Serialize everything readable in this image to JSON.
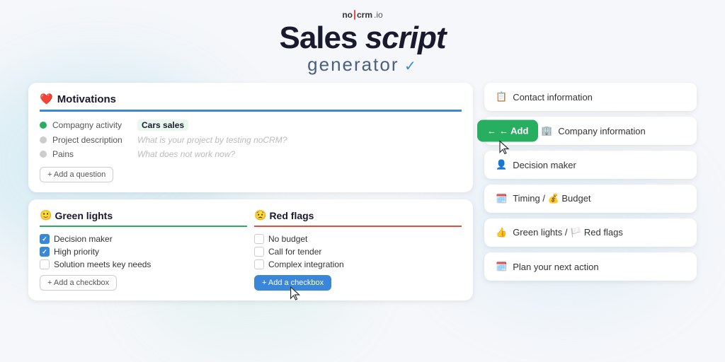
{
  "header": {
    "logo": "no|crm.io",
    "title_sales": "Sales",
    "title_script": "script",
    "subtitle": "generator",
    "logo_no": "no",
    "logo_crm": "crm",
    "logo_io": ".io"
  },
  "motivations": {
    "title": "Motivations",
    "title_icon": "❤️",
    "rows": [
      {
        "label": "Compagny activity",
        "value": "Cars sales",
        "active": true
      },
      {
        "label": "Project description",
        "placeholder": "What is your project by testing noCRM?",
        "active": false
      },
      {
        "label": "Pains",
        "placeholder": "What does not work now?",
        "active": false
      }
    ],
    "add_button": "+ Add a question"
  },
  "green_lights": {
    "title": "Green lights",
    "icon": "🙂",
    "items": [
      {
        "label": "Decision maker",
        "checked": true
      },
      {
        "label": "High priority",
        "checked": true
      },
      {
        "label": "Solution meets key needs",
        "checked": false
      }
    ],
    "add_button": "+ Add a checkbox"
  },
  "red_flags": {
    "title": "Red flags",
    "icon": "😟",
    "items": [
      {
        "label": "No budget",
        "checked": false
      },
      {
        "label": "Call for tender",
        "checked": false
      },
      {
        "label": "Complex integration",
        "checked": false
      }
    ],
    "add_button": "+ Add a checkbox"
  },
  "right_panel": {
    "cards": [
      {
        "icon": "📋",
        "label": "Contact information",
        "id": "contact-info"
      },
      {
        "icon": "🏢",
        "label": "Company information",
        "id": "company-info",
        "has_add": true
      },
      {
        "icon": "👤",
        "label": "Decision maker",
        "id": "decision-maker"
      },
      {
        "icon": "🗓️",
        "label": "Timing / 💰 Budget",
        "id": "timing-budget"
      },
      {
        "icon": "👍",
        "label": "Green lights / 🏳️ Red flags",
        "id": "green-red"
      },
      {
        "icon": "🗓️",
        "label": "Plan your next action",
        "id": "next-action"
      }
    ],
    "add_button": "← Add"
  }
}
